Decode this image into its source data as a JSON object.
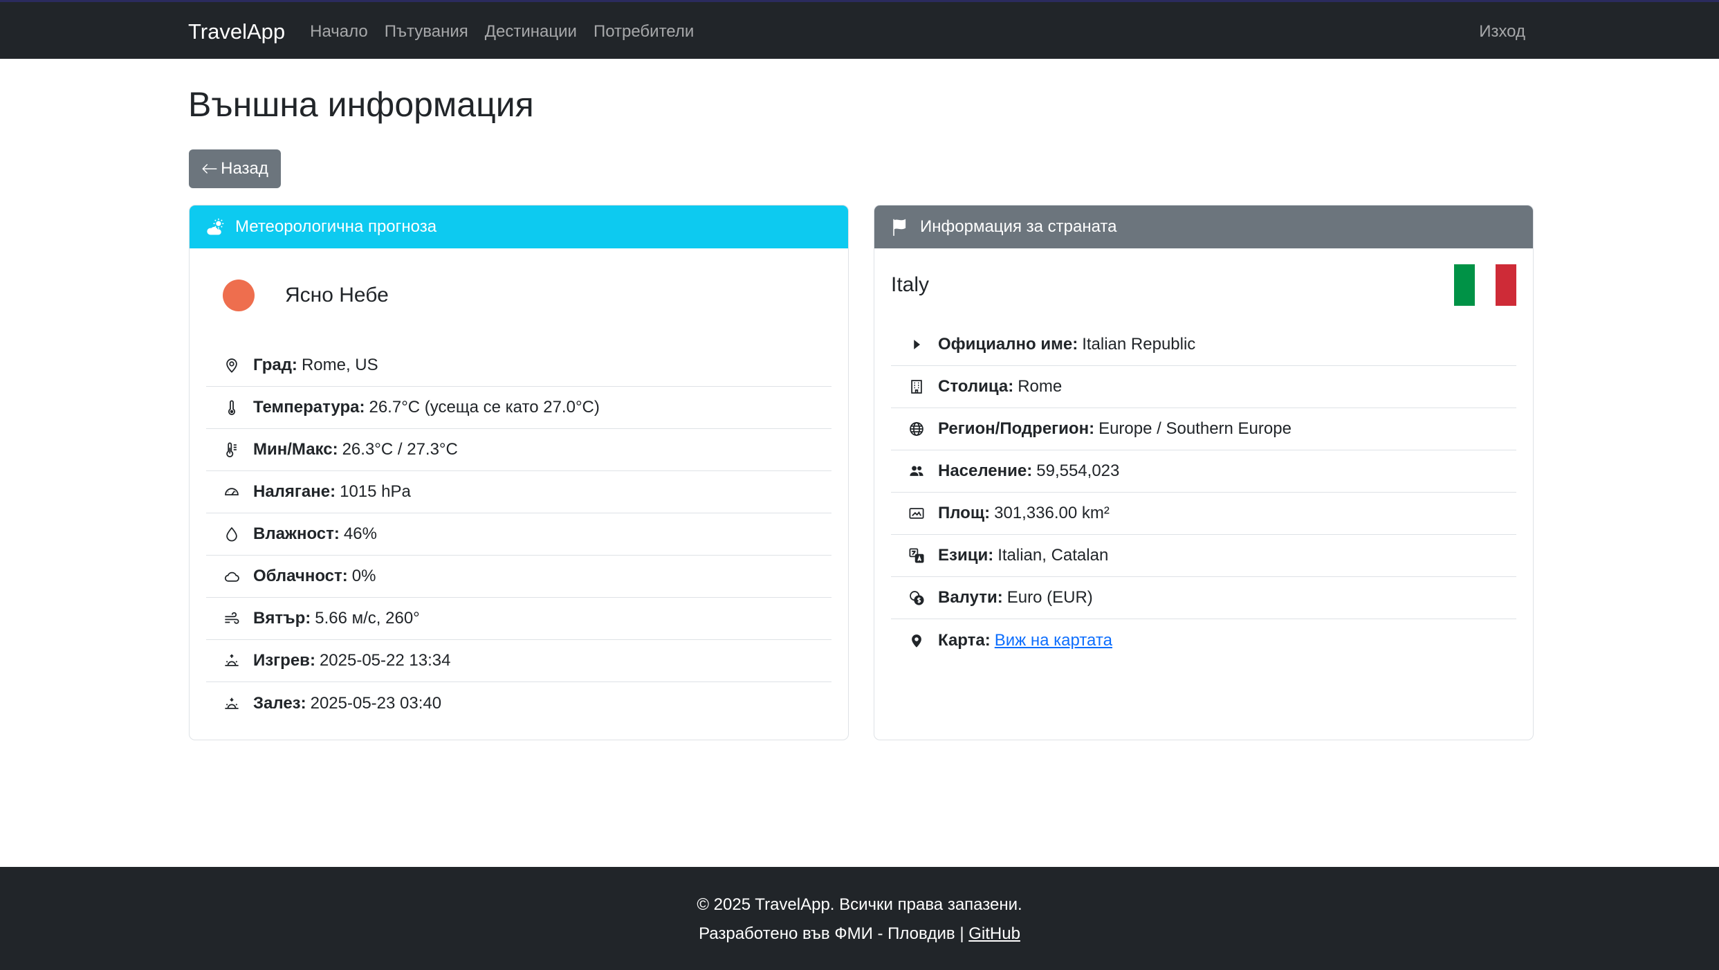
{
  "nav": {
    "brand": "TravelApp",
    "links": [
      "Начало",
      "Пътувания",
      "Дестинации",
      "Потребители"
    ],
    "logout": "Изход"
  },
  "page": {
    "title": "Външна информация",
    "back_label": "Назад",
    "back_icon": "arrow-left-icon"
  },
  "weather": {
    "header": "Метеорологична прогноза",
    "condition": "Ясно Небе",
    "items": [
      {
        "icon": "geo-alt-icon",
        "label": "Град:",
        "value": "Rome, US"
      },
      {
        "icon": "thermometer-icon",
        "label": "Температура:",
        "value": "26.7°C (усеща се като 27.0°C)"
      },
      {
        "icon": "thermometer-half-icon",
        "label": "Мин/Макс:",
        "value": "26.3°C / 27.3°C"
      },
      {
        "icon": "speedometer-icon",
        "label": "Налягане:",
        "value": "1015 hPa"
      },
      {
        "icon": "droplet-icon",
        "label": "Влажност:",
        "value": "46%"
      },
      {
        "icon": "cloud-icon",
        "label": "Облачност:",
        "value": "0%"
      },
      {
        "icon": "wind-icon",
        "label": "Вятър:",
        "value": "5.66 м/с, 260°"
      },
      {
        "icon": "sunrise-icon",
        "label": "Изгрев:",
        "value": "2025-05-22 13:34"
      },
      {
        "icon": "sunset-icon",
        "label": "Залез:",
        "value": "2025-05-23 03:40"
      }
    ]
  },
  "country": {
    "header": "Информация за страната",
    "name": "Italy",
    "flag_colors": [
      "#009246",
      "#ffffff",
      "#ce2b37"
    ],
    "items": [
      {
        "icon": "caret-right-icon",
        "label": "Официално име:",
        "value": "Italian Republic"
      },
      {
        "icon": "building-icon",
        "label": "Столица:",
        "value": "Rome"
      },
      {
        "icon": "globe-icon",
        "label": "Регион/Подрегион:",
        "value": "Europe / Southern Europe"
      },
      {
        "icon": "people-icon",
        "label": "Население:",
        "value": "59,554,023"
      },
      {
        "icon": "area-icon",
        "label": "Площ:",
        "value": "301,336.00 km²"
      },
      {
        "icon": "translate-icon",
        "label": "Езици:",
        "value": "Italian, Catalan"
      },
      {
        "icon": "coin-icon",
        "label": "Валути:",
        "value": "Euro (EUR)"
      },
      {
        "icon": "map-pin-icon",
        "label": "Карта:",
        "link": "Виж на картата"
      }
    ]
  },
  "footer": {
    "line1": "© 2025 TravelApp. Всички права запазени.",
    "line2": "Разработено във ФМИ - Пловдив |",
    "github": "GitHub"
  },
  "colors": {
    "navbar": "#212529",
    "weather_header": "#0dcaf0",
    "country_header": "#6c757d",
    "sun": "#ee6e4e",
    "link": "#0d6efd"
  }
}
